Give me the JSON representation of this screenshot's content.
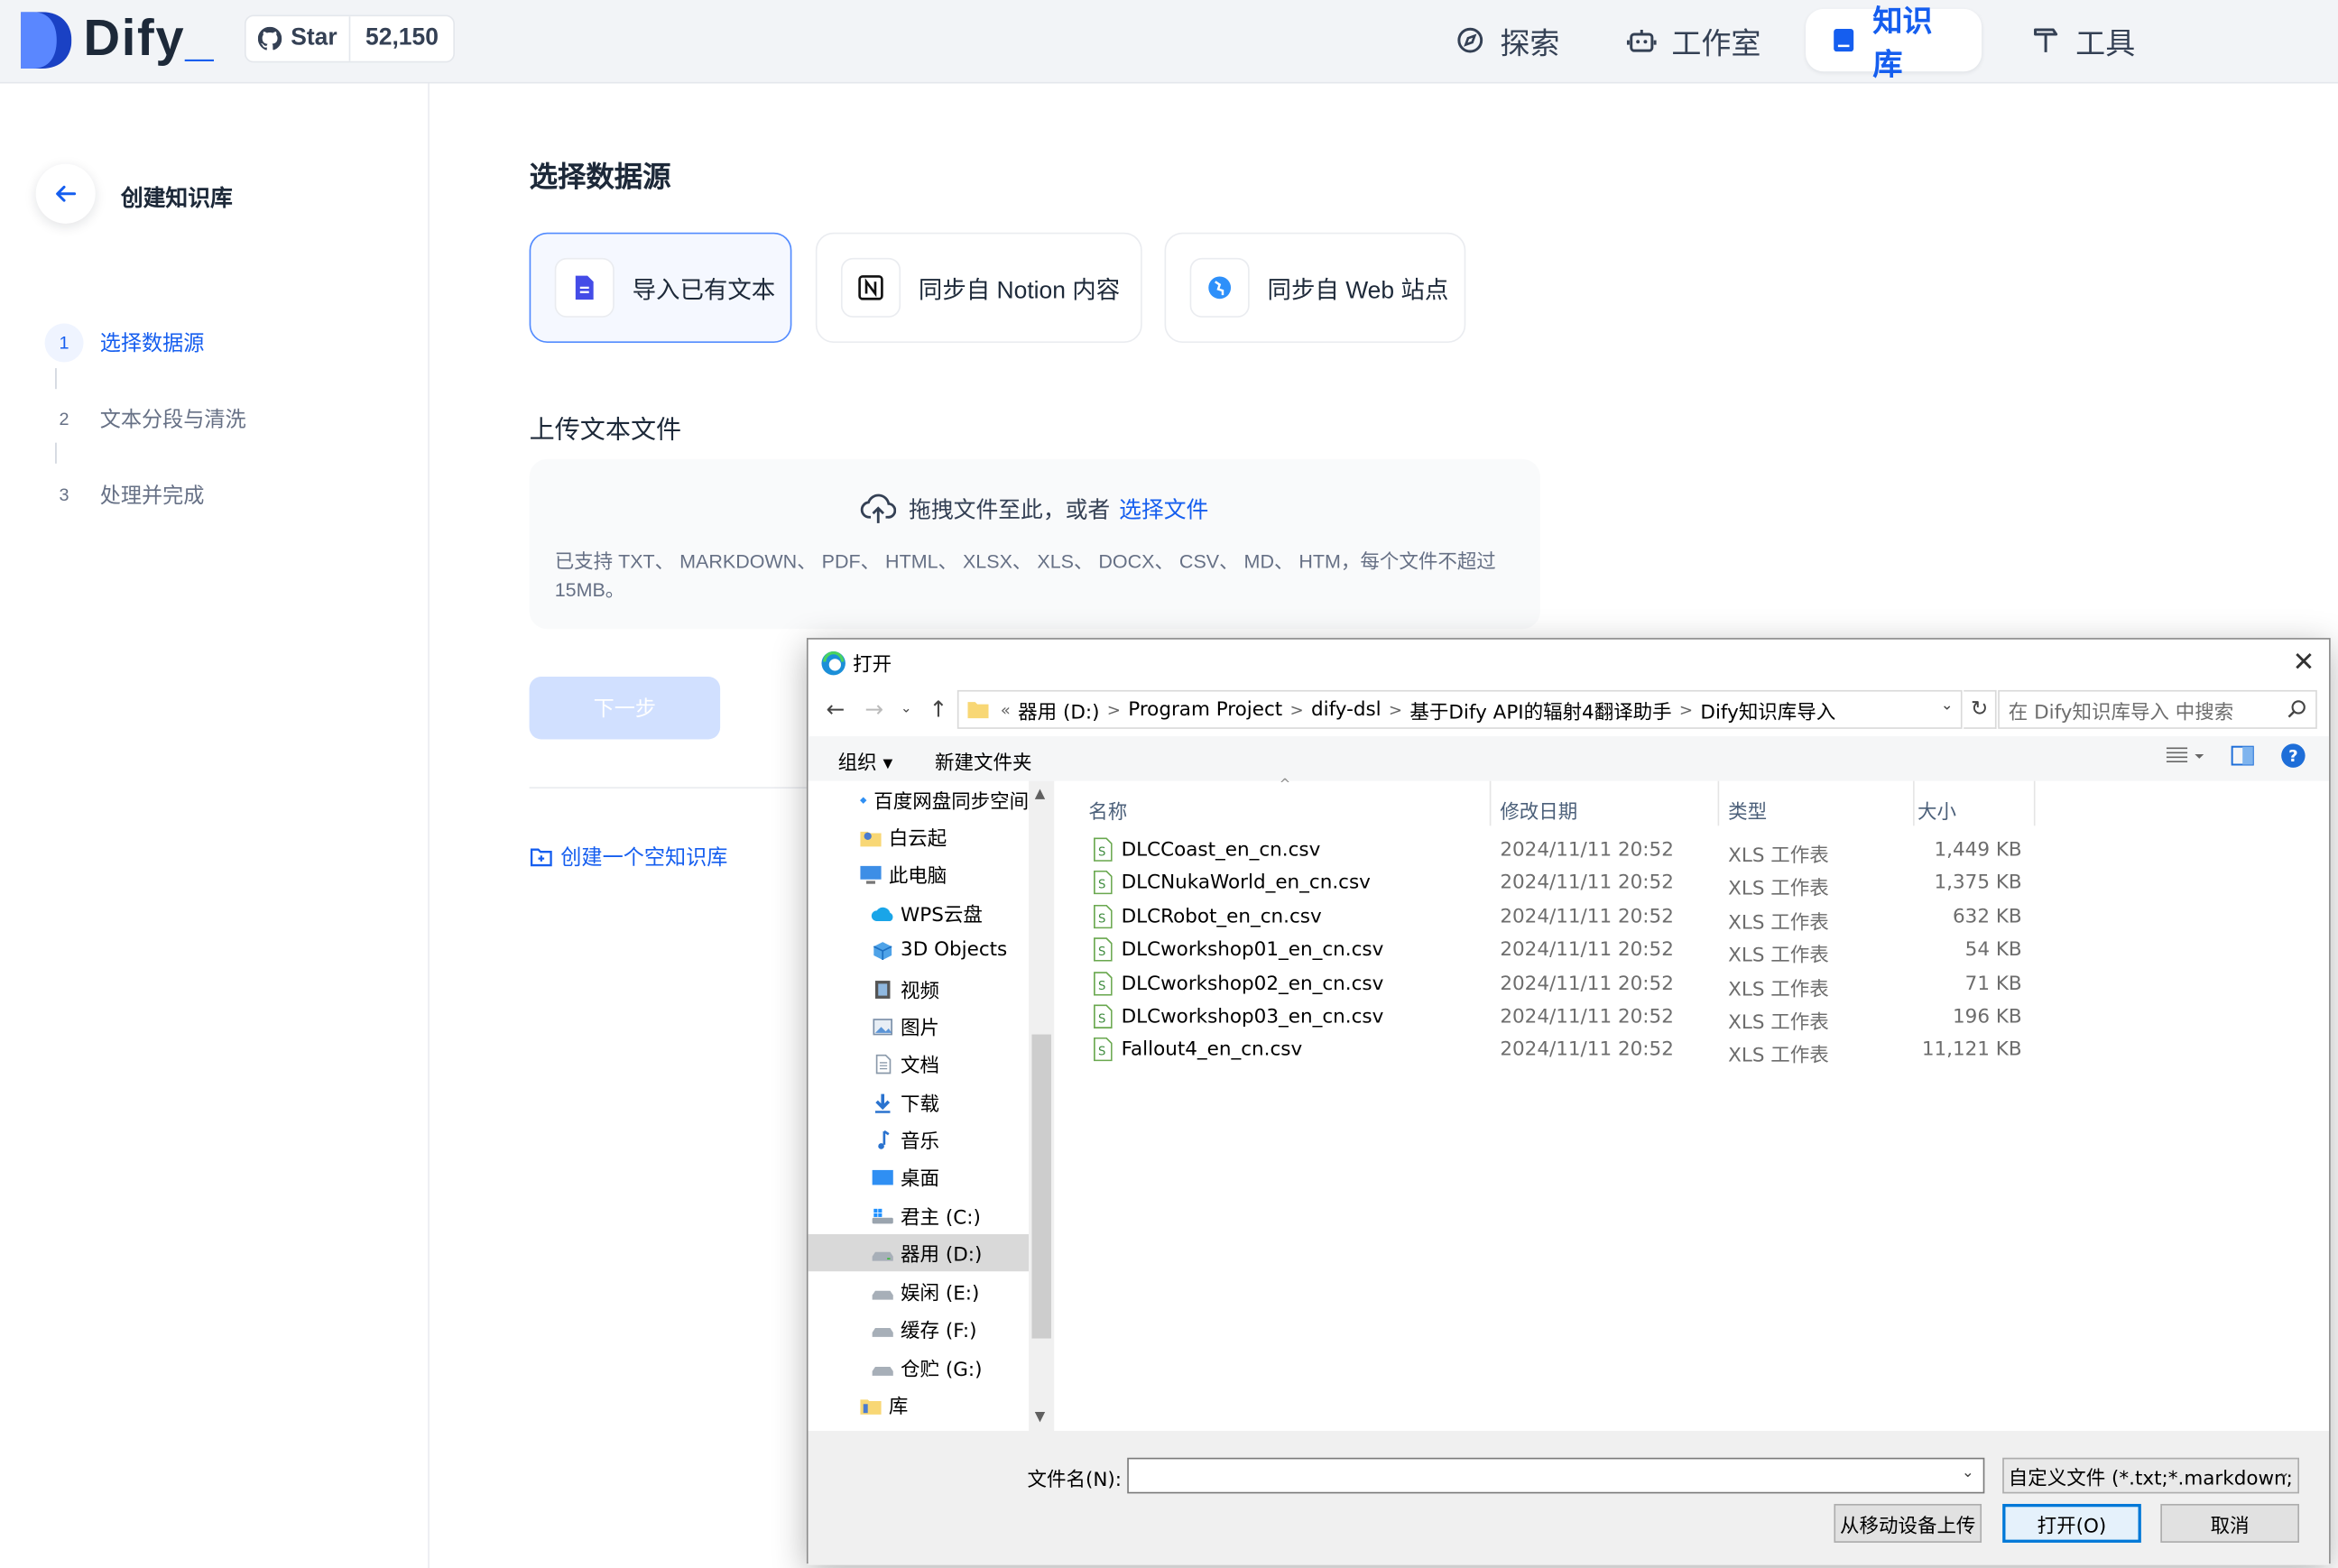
{
  "header": {
    "logo_text": "Dify",
    "star_label": "Star",
    "star_count": "52,150",
    "nav": [
      {
        "label": "探索",
        "icon": "compass-icon"
      },
      {
        "label": "工作室",
        "icon": "robot-icon"
      },
      {
        "label": "知识库",
        "icon": "book-icon",
        "active": true
      },
      {
        "label": "工具",
        "icon": "hammer-icon"
      }
    ]
  },
  "sidebar": {
    "title": "创建知识库",
    "steps": [
      {
        "num": "1",
        "label": "选择数据源",
        "active": true
      },
      {
        "num": "2",
        "label": "文本分段与清洗"
      },
      {
        "num": "3",
        "label": "处理并完成"
      }
    ]
  },
  "main": {
    "section_title": "选择数据源",
    "sources": [
      {
        "label": "导入已有文本",
        "icon": "file-text-icon",
        "active": true
      },
      {
        "label": "同步自 Notion 内容",
        "icon": "notion-icon"
      },
      {
        "label": "同步自 Web 站点",
        "icon": "globe-icon"
      }
    ],
    "upload_title": "上传文本文件",
    "drop_text": "拖拽文件至此，或者",
    "choose_file": "选择文件",
    "supported": "已支持 TXT、 MARKDOWN、 PDF、 HTML、 XLSX、 XLS、 DOCX、 CSV、 MD、 HTM，每个文件不超过 15MB。",
    "next_button": "下一步",
    "create_empty": "创建一个空知识库"
  },
  "dialog": {
    "title": "打开",
    "close": "✕",
    "breadcrumb": [
      "器用 (D:)",
      "Program Project",
      "dify-dsl",
      "基于Dify API的辐射4翻译助手",
      "Dify知识库导入"
    ],
    "search_placeholder": "在 Dify知识库导入 中搜索",
    "toolbar": {
      "organize": "组织 ▾",
      "new_folder": "新建文件夹"
    },
    "tree": [
      {
        "label": "百度网盘同步空间",
        "icon": "baidu-sync-icon",
        "indent": 0
      },
      {
        "label": "白云起",
        "icon": "user-folder-icon",
        "indent": 0
      },
      {
        "label": "此电脑",
        "icon": "computer-icon",
        "indent": 0
      },
      {
        "label": "WPS云盘",
        "icon": "cloud-icon",
        "indent": 1
      },
      {
        "label": "3D Objects",
        "icon": "cube-icon",
        "indent": 1
      },
      {
        "label": "视频",
        "icon": "video-folder-icon",
        "indent": 1
      },
      {
        "label": "图片",
        "icon": "picture-folder-icon",
        "indent": 1
      },
      {
        "label": "文档",
        "icon": "document-folder-icon",
        "indent": 1
      },
      {
        "label": "下载",
        "icon": "download-folder-icon",
        "indent": 1
      },
      {
        "label": "音乐",
        "icon": "music-folder-icon",
        "indent": 1
      },
      {
        "label": "桌面",
        "icon": "desktop-folder-icon",
        "indent": 1
      },
      {
        "label": "君主 (C:)",
        "icon": "system-drive-icon",
        "indent": 1
      },
      {
        "label": "器用 (D:)",
        "icon": "drive-icon",
        "indent": 1,
        "selected": true
      },
      {
        "label": "娱闲 (E:)",
        "icon": "drive-icon",
        "indent": 1
      },
      {
        "label": "缓存 (F:)",
        "icon": "drive-icon",
        "indent": 1
      },
      {
        "label": "仓贮 (G:)",
        "icon": "drive-icon",
        "indent": 1
      },
      {
        "label": "库",
        "icon": "library-icon",
        "indent": 0
      }
    ],
    "columns": {
      "name": "名称",
      "date": "修改日期",
      "type": "类型",
      "size": "大小"
    },
    "files": [
      {
        "name": "DLCCoast_en_cn.csv",
        "date": "2024/11/11 20:52",
        "type": "XLS 工作表",
        "size": "1,449 KB"
      },
      {
        "name": "DLCNukaWorld_en_cn.csv",
        "date": "2024/11/11 20:52",
        "type": "XLS 工作表",
        "size": "1,375 KB"
      },
      {
        "name": "DLCRobot_en_cn.csv",
        "date": "2024/11/11 20:52",
        "type": "XLS 工作表",
        "size": "632 KB"
      },
      {
        "name": "DLCworkshop01_en_cn.csv",
        "date": "2024/11/11 20:52",
        "type": "XLS 工作表",
        "size": "54 KB"
      },
      {
        "name": "DLCworkshop02_en_cn.csv",
        "date": "2024/11/11 20:52",
        "type": "XLS 工作表",
        "size": "71 KB"
      },
      {
        "name": "DLCworkshop03_en_cn.csv",
        "date": "2024/11/11 20:52",
        "type": "XLS 工作表",
        "size": "196 KB"
      },
      {
        "name": "Fallout4_en_cn.csv",
        "date": "2024/11/11 20:52",
        "type": "XLS 工作表",
        "size": "11,121 KB"
      }
    ],
    "filename_label": "文件名(N):",
    "filename_value": "",
    "filter": "自定义文件 (*.txt;*.markdown;",
    "buttons": {
      "mobile": "从移动设备上传",
      "open": "打开(O)",
      "cancel": "取消"
    }
  },
  "colors": {
    "accent": "#155eef",
    "header_bg": "#f2f4f7",
    "dialog_select": "#d9d9d9"
  }
}
